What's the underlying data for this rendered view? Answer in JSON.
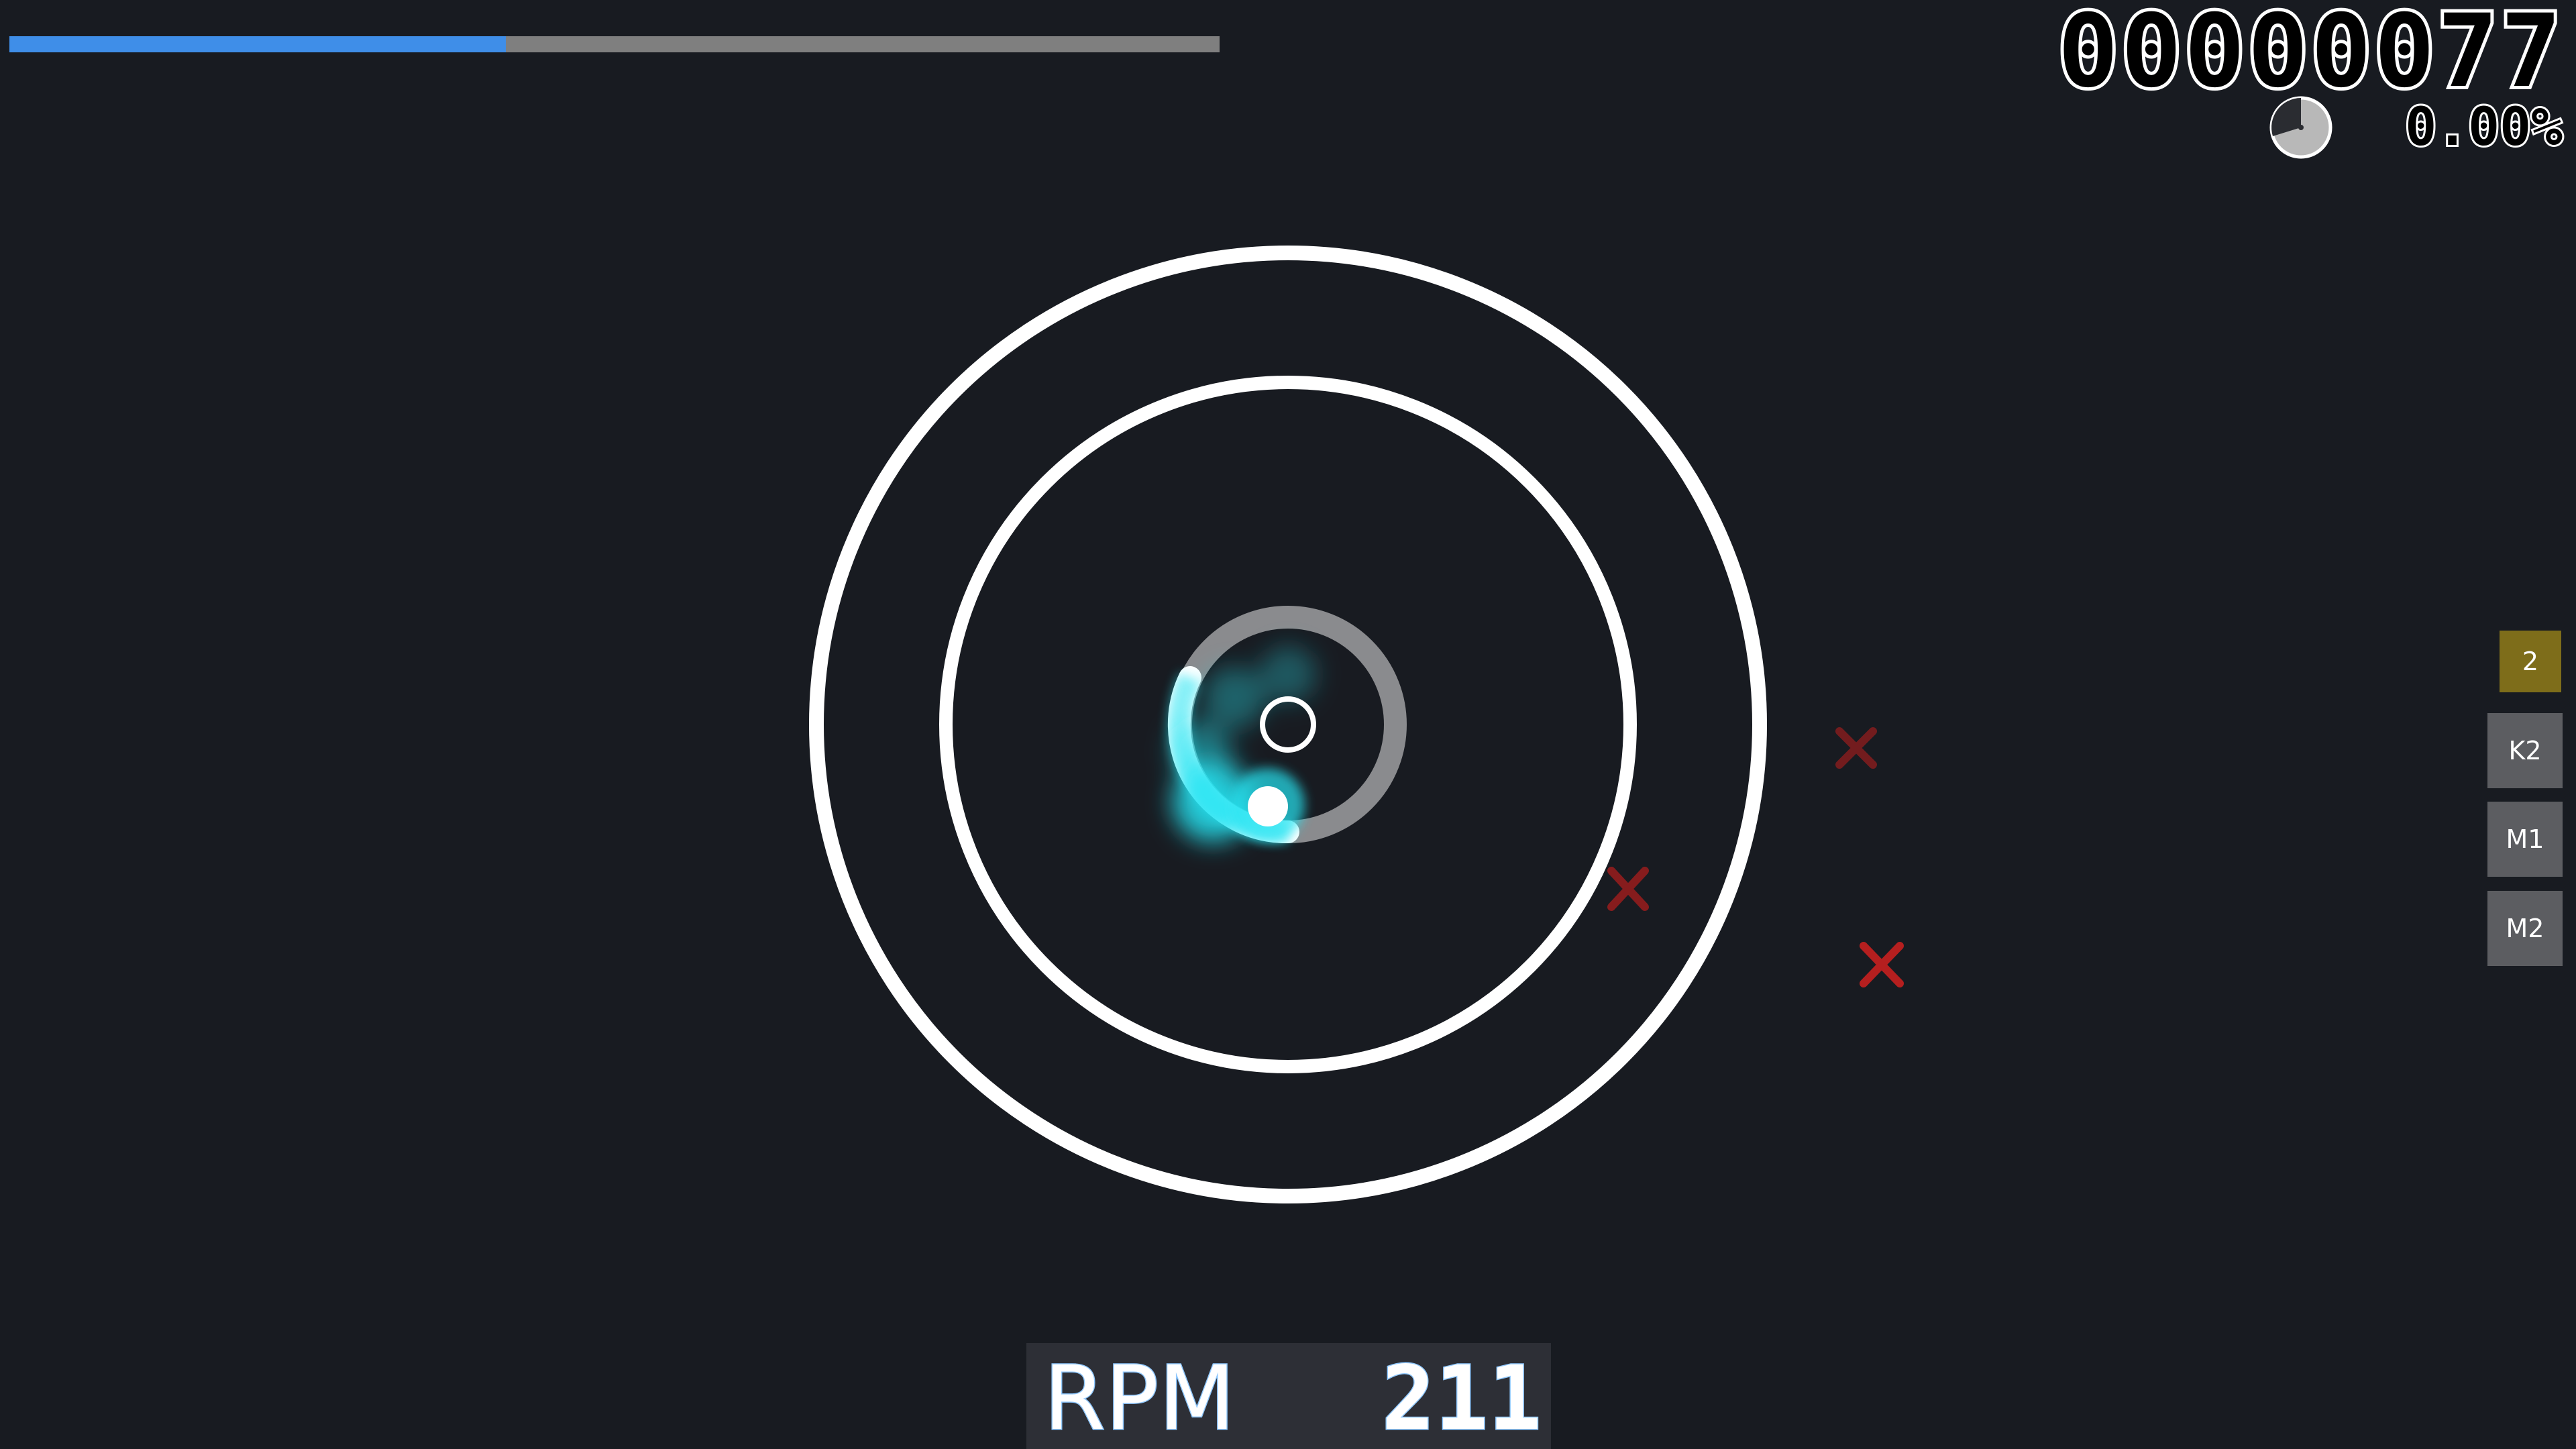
{
  "hud": {
    "score": "00000077",
    "accuracy": "0.00%",
    "song_progress": 0.41,
    "song_progress_track_color": "#7f7f7f",
    "song_progress_fill_color": "#3f8ee8",
    "elapsed_clock_icon": "clock-pie-icon"
  },
  "key_overlay": {
    "counter": "2",
    "keys": [
      "K2",
      "M1",
      "M2"
    ]
  },
  "spinner": {
    "rpm_label": "RPM",
    "rpm_value": "211",
    "approach_color": "#ffffff",
    "glow_color": "#27e4f2",
    "miss_marker_icon": "miss-x-icon",
    "miss_marker_color": "#9a1d1d"
  }
}
